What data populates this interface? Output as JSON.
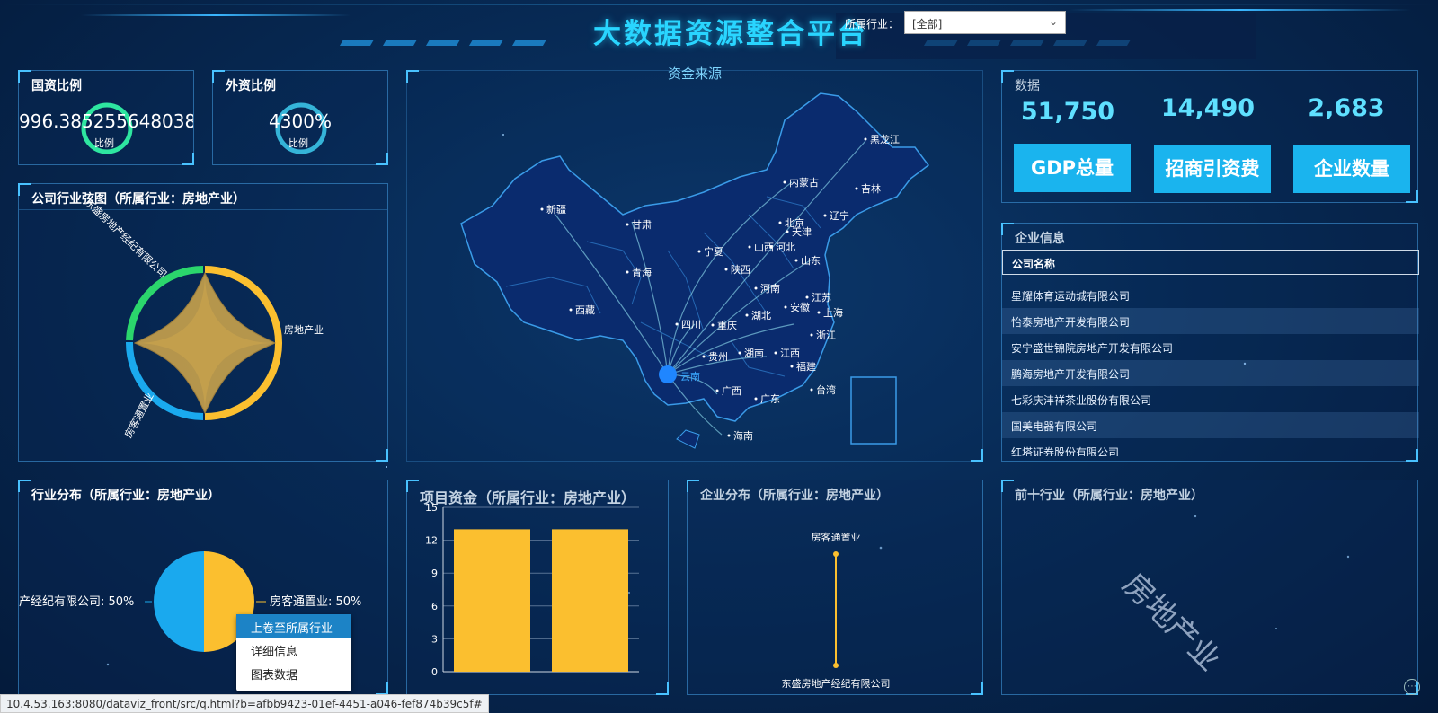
{
  "header": {
    "title": "大数据资源整合平台",
    "filter_label": "所属行业：",
    "filter_value": "[全部]"
  },
  "state_ratio": {
    "title": "国资比例",
    "value": "996.3852556480383%",
    "sub": "比例"
  },
  "foreign_ratio": {
    "title": "外资比例",
    "value": "4300%",
    "sub": "比例"
  },
  "chord": {
    "title": "公司行业弦图（所属行业：房地产业）",
    "labels": [
      "东盛房地产经纪有限公司",
      "房地产业",
      "房客通置业"
    ]
  },
  "map": {
    "title": "资金来源",
    "source": "云南",
    "provinces": [
      "新疆",
      "甘肃",
      "青海",
      "西藏",
      "内蒙古",
      "黑龙江",
      "吉林",
      "辽宁",
      "北京",
      "天津",
      "河北",
      "山西",
      "宁夏",
      "陕西",
      "山东",
      "河南",
      "江苏",
      "安徽",
      "上海",
      "四川",
      "重庆",
      "湖北",
      "浙江",
      "贵州",
      "湖南",
      "江西",
      "福建",
      "广西",
      "广东",
      "台湾",
      "海南"
    ]
  },
  "stats": {
    "label": "数据",
    "items": [
      {
        "value": "51,750",
        "button": "GDP总量"
      },
      {
        "value": "14,490",
        "button": "招商引资费"
      },
      {
        "value": "2,683",
        "button": "企业数量"
      }
    ]
  },
  "companies": {
    "title": "企业信息",
    "column": "公司名称",
    "rows": [
      "星耀体育运动城有限公司",
      "怡泰房地产开发有限公司",
      "安宁盛世锦院房地产开发有限公司",
      "鹏海房地产开发有限公司",
      "七彩庆沣祥茶业股份有限公司",
      "国美电器有限公司",
      "红塔证券股份有限公司"
    ]
  },
  "industry_dist": {
    "title": "行业分布（所属行业：房地产业）",
    "left_label": "产经纪有限公司: 50%",
    "right_label": "房客通置业: 50%"
  },
  "project_funds": {
    "title": "项目资金（所属行业：房地产业）"
  },
  "enterprise_dist": {
    "title": "企业分布（所属行业：房地产业）",
    "top_label": "房客通置业",
    "bottom_label": "东盛房地产经纪有限公司"
  },
  "top10": {
    "title": "前十行业（所属行业：房地产业）",
    "word": "房地产业"
  },
  "context_menu": {
    "items": [
      "上卷至所属行业",
      "详细信息",
      "图表数据"
    ]
  },
  "status_bar": {
    "url": "10.4.53.163:8080/dataviz_front/src/q.html?b=afbb9423-01ef-4451-a046-fef874b39c5f#"
  },
  "colors": {
    "accent": "#29d5ff",
    "yellow": "#fbbf2f",
    "blue": "#1aa9ee",
    "green": "#2bd66c"
  },
  "chart_data": [
    {
      "type": "bar",
      "title": "",
      "categories": [
        "",
        ""
      ],
      "values": [
        13,
        13
      ],
      "ylim": [
        0,
        15
      ],
      "yticks": [
        0,
        3,
        6,
        9,
        12,
        15
      ],
      "grid": true
    },
    {
      "type": "pie",
      "slices": [
        {
          "label": "产经纪有限公司",
          "value": 50,
          "color": "#1aa9ee"
        },
        {
          "label": "房客通置业",
          "value": 50,
          "color": "#fbbf2f"
        }
      ]
    }
  ]
}
